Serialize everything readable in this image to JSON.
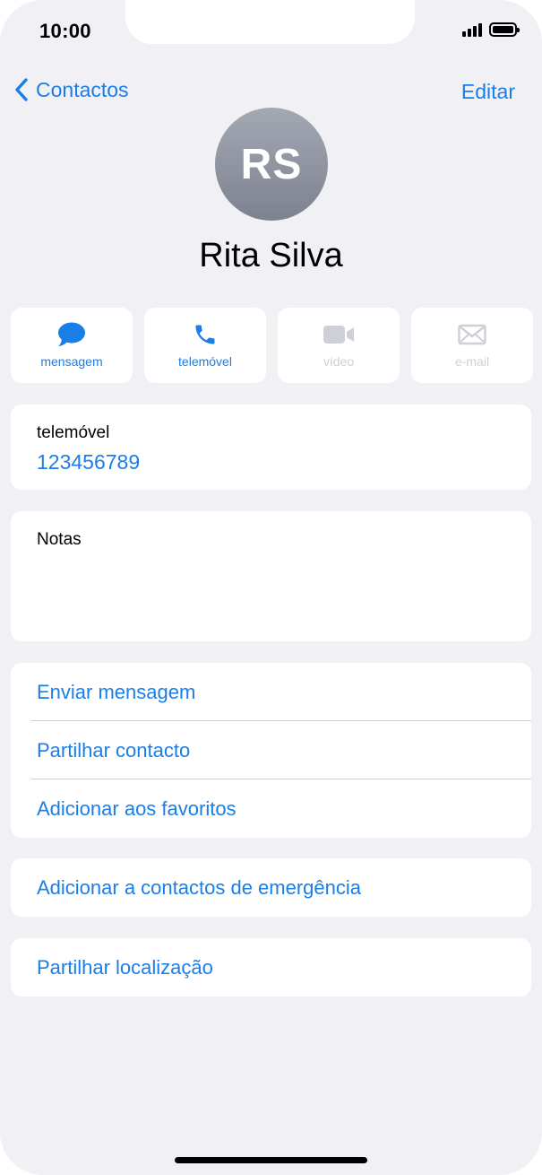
{
  "status_bar": {
    "time": "10:00",
    "signal_bars": 4,
    "battery_level": 1.0
  },
  "nav": {
    "back_label": "Contactos",
    "edit_label": "Editar"
  },
  "contact": {
    "initials": "RS",
    "name": "Rita Silva"
  },
  "actions": [
    {
      "label": "mensagem",
      "icon": "message-bubble-icon",
      "enabled": true
    },
    {
      "label": "telemóvel",
      "icon": "phone-icon",
      "enabled": true
    },
    {
      "label": "vídeo",
      "icon": "video-camera-icon",
      "enabled": false
    },
    {
      "label": "e-mail",
      "icon": "envelope-icon",
      "enabled": false
    }
  ],
  "phone_card": {
    "caption": "telemóvel",
    "number": "123456789"
  },
  "notes_card": {
    "label": "Notas"
  },
  "list": [
    {
      "label": "Enviar mensagem"
    },
    {
      "label": "Partilhar contacto"
    },
    {
      "label": "Adicionar aos favoritos"
    }
  ],
  "emergency": {
    "label": "Adicionar a contactos de emergência"
  },
  "location": {
    "label": "Partilhar localização"
  },
  "colors": {
    "accent": "#1a7ee8",
    "background": "#f0f0f5",
    "card": "#ffffff",
    "disabled": "#cdd0d6"
  }
}
